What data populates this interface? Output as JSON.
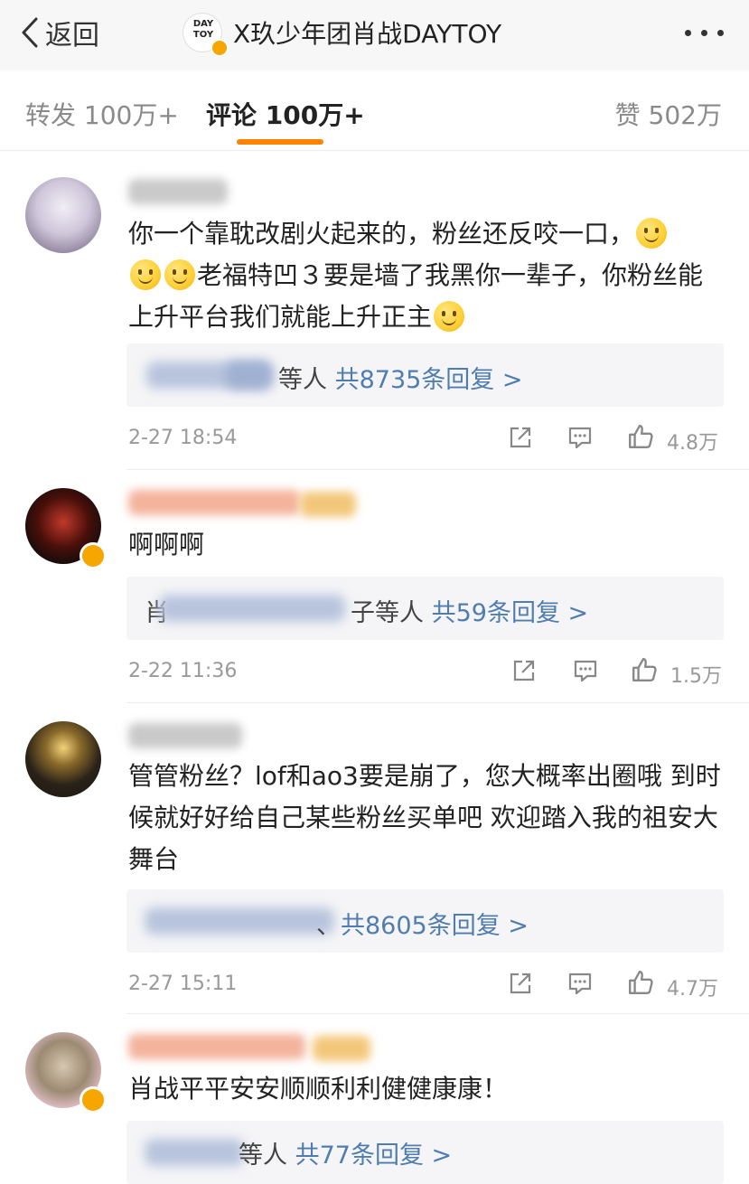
{
  "header": {
    "back_label": "返回",
    "title": "X玖少年团肖战DAYTOY",
    "logo_text": "DAY\nTOY"
  },
  "tabs": {
    "repost": "转发 100万+",
    "comment": "评论 100万+",
    "like": "赞 502万"
  },
  "colors": {
    "accent": "#ff8200",
    "link": "#507daf",
    "verified_badge": "#f7a600"
  },
  "comments": [
    {
      "text": "你一个靠耽改剧火起来的，粉丝还反咬一口，",
      "text2": "老福特凹３要是墙了我黑你一辈子，你粉丝能上升平台我们就能上升正主",
      "reply_suffix": "等人",
      "reply_count": "共8735条回复 >",
      "time": "2-27 18:54",
      "likes": "4.8万"
    },
    {
      "text": "啊啊啊",
      "reply_prefix": "肖",
      "reply_suffix": "子等人",
      "reply_count": "共59条回复 >",
      "time": "2-22 11:36",
      "likes": "1.5万"
    },
    {
      "text": "管管粉丝？lof和ao3要是崩了，您大概率出圈哦 到时候就好好给自己某些粉丝买单吧 欢迎踏入我的祖安大舞台",
      "reply_suffix": "、",
      "reply_count": "共8605条回复 >",
      "time": "2-27 15:11",
      "likes": "4.7万"
    },
    {
      "text": "肖战平平安安顺顺利利健健康康！",
      "reply_suffix": "等人",
      "reply_count": "共77条回复 >"
    }
  ],
  "icons": [
    "chevron-left-icon",
    "more-icon",
    "share-icon",
    "comment-icon",
    "thumbs-up-icon",
    "verified-icon",
    "smile-emoji-icon"
  ]
}
